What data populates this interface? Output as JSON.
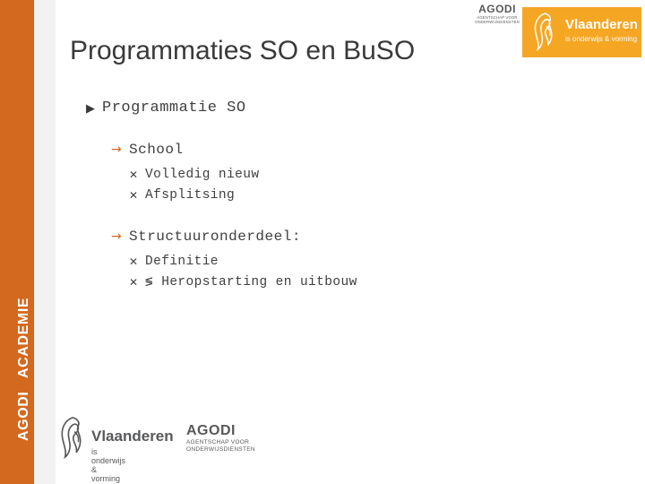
{
  "slide": {
    "title": "Programmaties SO en BuSO"
  },
  "branding": {
    "agodi_word": "AGODI",
    "agodi_sub_line1": "AGENTSCHAP VOOR",
    "agodi_sub_line2": "ONDERWIJSDIENSTEN",
    "vlaanderen_word": "Vlaanderen",
    "vlaanderen_sub": "is onderwijs & vorming",
    "badge_color": "#F5A623",
    "accent_color": "#D2691E"
  },
  "sidebar": {
    "vertical_line1": "AGODI",
    "vertical_line2": "ACADEMIE"
  },
  "content": {
    "level1": {
      "marker": "▶",
      "text": "Programmatie SO"
    },
    "groups": [
      {
        "marker": "→",
        "heading": "School",
        "items": [
          {
            "marker": "✕",
            "text": "Volledig nieuw"
          },
          {
            "marker": "✕",
            "text": "Afsplitsing"
          }
        ]
      },
      {
        "marker": "→",
        "heading": "Structuuronderdeel:",
        "items": [
          {
            "marker": "✕",
            "text": "Definitie"
          },
          {
            "marker": "✕",
            "text": "≶ Heropstarting en uitbouw"
          }
        ]
      }
    ]
  },
  "footer": {
    "vlaanderen_word": "Vlaanderen",
    "vlaanderen_sub": "is onderwijs & vorming",
    "agodi_word": "AGODI",
    "agodi_sub_line1": "AGENTSCHAP VOOR",
    "agodi_sub_line2": "ONDERWIJSDIENSTEN"
  }
}
